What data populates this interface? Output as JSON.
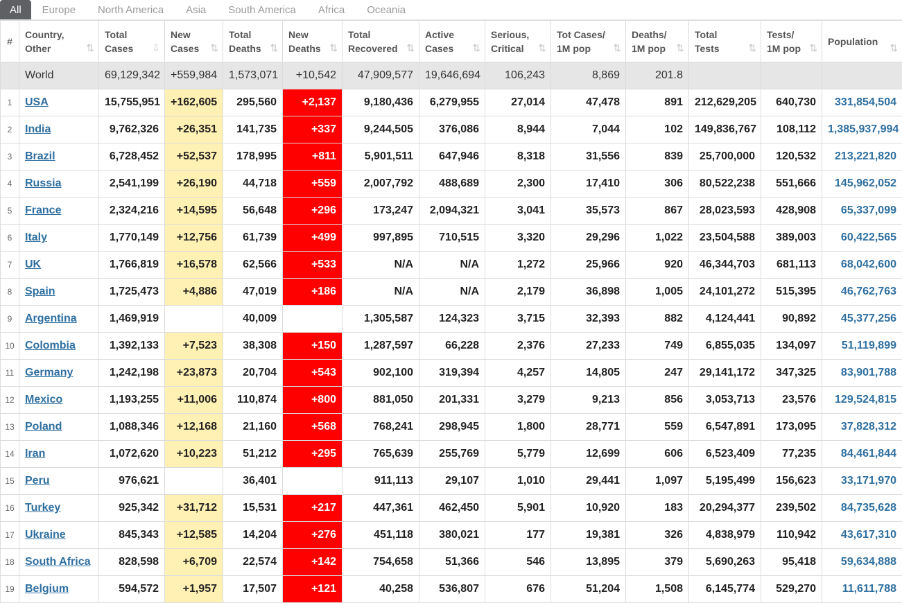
{
  "tabs": [
    "All",
    "Europe",
    "North America",
    "Asia",
    "South America",
    "Africa",
    "Oceania"
  ],
  "headers": {
    "num": "#",
    "country": [
      "Country,",
      "Other"
    ],
    "total_cases": [
      "Total",
      "Cases"
    ],
    "new_cases": [
      "New",
      "Cases"
    ],
    "total_deaths": [
      "Total",
      "Deaths"
    ],
    "new_deaths": [
      "New",
      "Deaths"
    ],
    "total_recovered": [
      "Total",
      "Recovered"
    ],
    "active_cases": [
      "Active",
      "Cases"
    ],
    "serious": [
      "Serious,",
      "Critical"
    ],
    "cases_per_m": [
      "Tot Cases/",
      "1M pop"
    ],
    "deaths_per_m": [
      "Deaths/",
      "1M pop"
    ],
    "total_tests": [
      "Total",
      "Tests"
    ],
    "tests_per_m": [
      "Tests/",
      "1M pop"
    ],
    "population": [
      "Population",
      ""
    ]
  },
  "world": {
    "country": "World",
    "total_cases": "69,129,342",
    "new_cases": "+559,984",
    "total_deaths": "1,573,071",
    "new_deaths": "+10,542",
    "total_recovered": "47,909,577",
    "active_cases": "19,646,694",
    "serious": "106,243",
    "cases_per_m": "8,869",
    "deaths_per_m": "201.8",
    "total_tests": "",
    "tests_per_m": "",
    "population": ""
  },
  "rows": [
    {
      "num": "1",
      "country": "USA",
      "total_cases": "15,755,951",
      "new_cases": "+162,605",
      "total_deaths": "295,560",
      "new_deaths": "+2,137",
      "total_recovered": "9,180,436",
      "active_cases": "6,279,955",
      "serious": "27,014",
      "cases_per_m": "47,478",
      "deaths_per_m": "891",
      "total_tests": "212,629,205",
      "tests_per_m": "640,730",
      "population": "331,854,504"
    },
    {
      "num": "2",
      "country": "India",
      "total_cases": "9,762,326",
      "new_cases": "+26,351",
      "total_deaths": "141,735",
      "new_deaths": "+337",
      "total_recovered": "9,244,505",
      "active_cases": "376,086",
      "serious": "8,944",
      "cases_per_m": "7,044",
      "deaths_per_m": "102",
      "total_tests": "149,836,767",
      "tests_per_m": "108,112",
      "population": "1,385,937,994"
    },
    {
      "num": "3",
      "country": "Brazil",
      "total_cases": "6,728,452",
      "new_cases": "+52,537",
      "total_deaths": "178,995",
      "new_deaths": "+811",
      "total_recovered": "5,901,511",
      "active_cases": "647,946",
      "serious": "8,318",
      "cases_per_m": "31,556",
      "deaths_per_m": "839",
      "total_tests": "25,700,000",
      "tests_per_m": "120,532",
      "population": "213,221,820"
    },
    {
      "num": "4",
      "country": "Russia",
      "total_cases": "2,541,199",
      "new_cases": "+26,190",
      "total_deaths": "44,718",
      "new_deaths": "+559",
      "total_recovered": "2,007,792",
      "active_cases": "488,689",
      "serious": "2,300",
      "cases_per_m": "17,410",
      "deaths_per_m": "306",
      "total_tests": "80,522,238",
      "tests_per_m": "551,666",
      "population": "145,962,052"
    },
    {
      "num": "5",
      "country": "France",
      "total_cases": "2,324,216",
      "new_cases": "+14,595",
      "total_deaths": "56,648",
      "new_deaths": "+296",
      "total_recovered": "173,247",
      "active_cases": "2,094,321",
      "serious": "3,041",
      "cases_per_m": "35,573",
      "deaths_per_m": "867",
      "total_tests": "28,023,593",
      "tests_per_m": "428,908",
      "population": "65,337,099"
    },
    {
      "num": "6",
      "country": "Italy",
      "total_cases": "1,770,149",
      "new_cases": "+12,756",
      "total_deaths": "61,739",
      "new_deaths": "+499",
      "total_recovered": "997,895",
      "active_cases": "710,515",
      "serious": "3,320",
      "cases_per_m": "29,296",
      "deaths_per_m": "1,022",
      "total_tests": "23,504,588",
      "tests_per_m": "389,003",
      "population": "60,422,565"
    },
    {
      "num": "7",
      "country": "UK",
      "total_cases": "1,766,819",
      "new_cases": "+16,578",
      "total_deaths": "62,566",
      "new_deaths": "+533",
      "total_recovered": "N/A",
      "active_cases": "N/A",
      "serious": "1,272",
      "cases_per_m": "25,966",
      "deaths_per_m": "920",
      "total_tests": "46,344,703",
      "tests_per_m": "681,113",
      "population": "68,042,600"
    },
    {
      "num": "8",
      "country": "Spain",
      "total_cases": "1,725,473",
      "new_cases": "+4,886",
      "total_deaths": "47,019",
      "new_deaths": "+186",
      "total_recovered": "N/A",
      "active_cases": "N/A",
      "serious": "2,179",
      "cases_per_m": "36,898",
      "deaths_per_m": "1,005",
      "total_tests": "24,101,272",
      "tests_per_m": "515,395",
      "population": "46,762,763"
    },
    {
      "num": "9",
      "country": "Argentina",
      "total_cases": "1,469,919",
      "new_cases": "",
      "total_deaths": "40,009",
      "new_deaths": "",
      "total_recovered": "1,305,587",
      "active_cases": "124,323",
      "serious": "3,715",
      "cases_per_m": "32,393",
      "deaths_per_m": "882",
      "total_tests": "4,124,441",
      "tests_per_m": "90,892",
      "population": "45,377,256"
    },
    {
      "num": "10",
      "country": "Colombia",
      "total_cases": "1,392,133",
      "new_cases": "+7,523",
      "total_deaths": "38,308",
      "new_deaths": "+150",
      "total_recovered": "1,287,597",
      "active_cases": "66,228",
      "serious": "2,376",
      "cases_per_m": "27,233",
      "deaths_per_m": "749",
      "total_tests": "6,855,035",
      "tests_per_m": "134,097",
      "population": "51,119,899"
    },
    {
      "num": "11",
      "country": "Germany",
      "total_cases": "1,242,198",
      "new_cases": "+23,873",
      "total_deaths": "20,704",
      "new_deaths": "+543",
      "total_recovered": "902,100",
      "active_cases": "319,394",
      "serious": "4,257",
      "cases_per_m": "14,805",
      "deaths_per_m": "247",
      "total_tests": "29,141,172",
      "tests_per_m": "347,325",
      "population": "83,901,788"
    },
    {
      "num": "12",
      "country": "Mexico",
      "total_cases": "1,193,255",
      "new_cases": "+11,006",
      "total_deaths": "110,874",
      "new_deaths": "+800",
      "total_recovered": "881,050",
      "active_cases": "201,331",
      "serious": "3,279",
      "cases_per_m": "9,213",
      "deaths_per_m": "856",
      "total_tests": "3,053,713",
      "tests_per_m": "23,576",
      "population": "129,524,815"
    },
    {
      "num": "13",
      "country": "Poland",
      "total_cases": "1,088,346",
      "new_cases": "+12,168",
      "total_deaths": "21,160",
      "new_deaths": "+568",
      "total_recovered": "768,241",
      "active_cases": "298,945",
      "serious": "1,800",
      "cases_per_m": "28,771",
      "deaths_per_m": "559",
      "total_tests": "6,547,891",
      "tests_per_m": "173,095",
      "population": "37,828,312"
    },
    {
      "num": "14",
      "country": "Iran",
      "total_cases": "1,072,620",
      "new_cases": "+10,223",
      "total_deaths": "51,212",
      "new_deaths": "+295",
      "total_recovered": "765,639",
      "active_cases": "255,769",
      "serious": "5,779",
      "cases_per_m": "12,699",
      "deaths_per_m": "606",
      "total_tests": "6,523,409",
      "tests_per_m": "77,235",
      "population": "84,461,844"
    },
    {
      "num": "15",
      "country": "Peru",
      "total_cases": "976,621",
      "new_cases": "",
      "total_deaths": "36,401",
      "new_deaths": "",
      "total_recovered": "911,113",
      "active_cases": "29,107",
      "serious": "1,010",
      "cases_per_m": "29,441",
      "deaths_per_m": "1,097",
      "total_tests": "5,195,499",
      "tests_per_m": "156,623",
      "population": "33,171,970"
    },
    {
      "num": "16",
      "country": "Turkey",
      "total_cases": "925,342",
      "new_cases": "+31,712",
      "total_deaths": "15,531",
      "new_deaths": "+217",
      "total_recovered": "447,361",
      "active_cases": "462,450",
      "serious": "5,901",
      "cases_per_m": "10,920",
      "deaths_per_m": "183",
      "total_tests": "20,294,377",
      "tests_per_m": "239,502",
      "population": "84,735,628"
    },
    {
      "num": "17",
      "country": "Ukraine",
      "total_cases": "845,343",
      "new_cases": "+12,585",
      "total_deaths": "14,204",
      "new_deaths": "+276",
      "total_recovered": "451,118",
      "active_cases": "380,021",
      "serious": "177",
      "cases_per_m": "19,381",
      "deaths_per_m": "326",
      "total_tests": "4,838,979",
      "tests_per_m": "110,942",
      "population": "43,617,310"
    },
    {
      "num": "18",
      "country": "South Africa",
      "total_cases": "828,598",
      "new_cases": "+6,709",
      "total_deaths": "22,574",
      "new_deaths": "+142",
      "total_recovered": "754,658",
      "active_cases": "51,366",
      "serious": "546",
      "cases_per_m": "13,895",
      "deaths_per_m": "379",
      "total_tests": "5,690,263",
      "tests_per_m": "95,418",
      "population": "59,634,888"
    },
    {
      "num": "19",
      "country": "Belgium",
      "total_cases": "594,572",
      "new_cases": "+1,957",
      "total_deaths": "17,507",
      "new_deaths": "+121",
      "total_recovered": "40,258",
      "active_cases": "536,807",
      "serious": "676",
      "cases_per_m": "51,204",
      "deaths_per_m": "1,508",
      "total_tests": "6,145,774",
      "tests_per_m": "529,270",
      "population": "11,611,788"
    }
  ]
}
